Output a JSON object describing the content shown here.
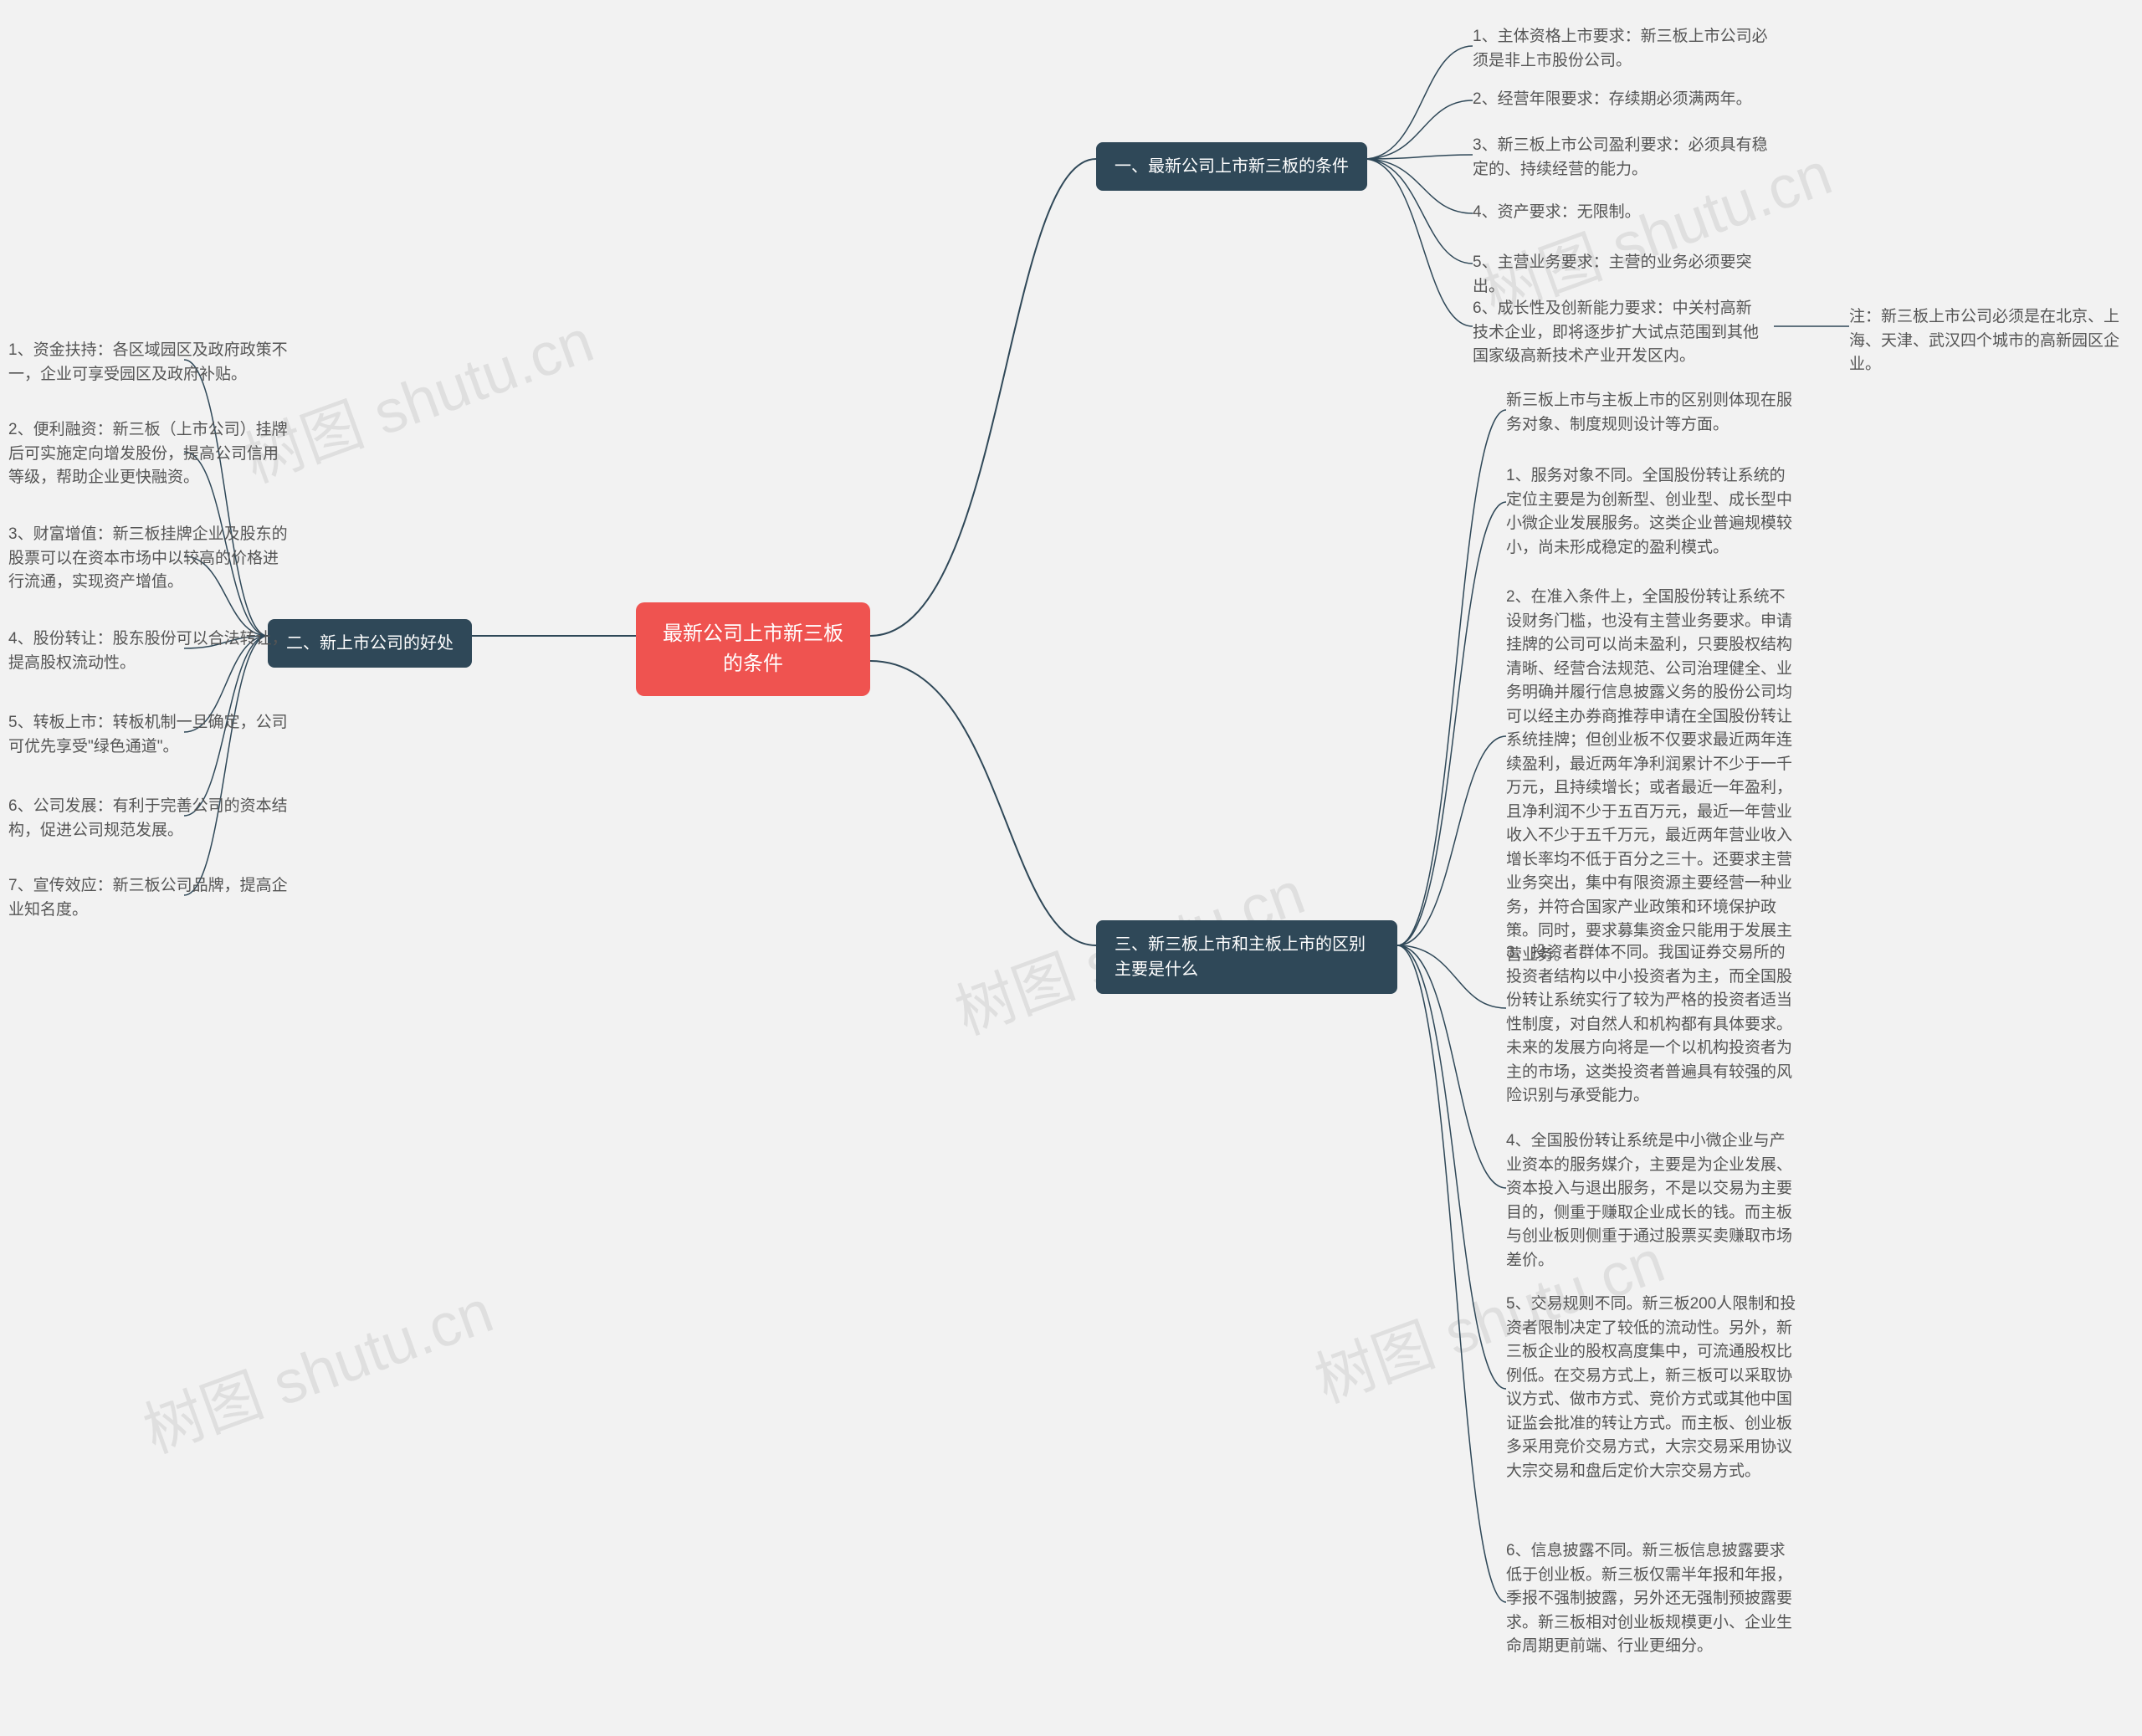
{
  "root": {
    "title": "最新公司上市新三板的条件"
  },
  "watermark": "树图 shutu.cn",
  "branch1": {
    "title": "一、最新公司上市新三板的条件",
    "items": [
      "1、主体资格上市要求：新三板上市公司必须是非上市股份公司。",
      "2、经营年限要求：存续期必须满两年。",
      "3、新三板上市公司盈利要求：必须具有稳定的、持续经营的能力。",
      "4、资产要求：无限制。",
      "5、主营业务要求：主营的业务必须要突出。",
      "6、成长性及创新能力要求：中关村高新技术企业，即将逐步扩大试点范围到其他国家级高新技术产业开发区内。"
    ],
    "note": "注：新三板上市公司必须是在北京、上海、天津、武汉四个城市的高新园区企业。"
  },
  "branch2": {
    "title": "二、新上市公司的好处",
    "items": [
      "1、资金扶持：各区域园区及政府政策不一，企业可享受园区及政府补贴。",
      "2、便利融资：新三板（上市公司）挂牌后可实施定向增发股份，提高公司信用等级，帮助企业更快融资。",
      "3、财富增值：新三板挂牌企业及股东的股票可以在资本市场中以较高的价格进行流通，实现资产增值。",
      "4、股份转让：股东股份可以合法转让，提高股权流动性。",
      "5、转板上市：转板机制一旦确定，公司可优先享受\"绿色通道\"。",
      "6、公司发展：有利于完善公司的资本结构，促进公司规范发展。",
      "7、宣传效应：新三板公司品牌，提高企业知名度。"
    ]
  },
  "branch3": {
    "title": "三、新三板上市和主板上市的区别主要是什么",
    "items": [
      "新三板上市与主板上市的区别则体现在服务对象、制度规则设计等方面。",
      "1、服务对象不同。全国股份转让系统的定位主要是为创新型、创业型、成长型中小微企业发展服务。这类企业普遍规模较小，尚未形成稳定的盈利模式。",
      "2、在准入条件上，全国股份转让系统不设财务门槛，也没有主营业务要求。申请挂牌的公司可以尚未盈利，只要股权结构清晰、经营合法规范、公司治理健全、业务明确并履行信息披露义务的股份公司均可以经主办券商推荐申请在全国股份转让系统挂牌；但创业板不仅要求最近两年连续盈利，最近两年净利润累计不少于一千万元，且持续增长；或者最近一年盈利，且净利润不少于五百万元，最近一年营业收入不少于五千万元，最近两年营业收入增长率均不低于百分之三十。还要求主营业务突出，集中有限资源主要经营一种业务，并符合国家产业政策和环境保护政策。同时，要求募集资金只能用于发展主营业务。",
      "3、投资者群体不同。我国证券交易所的投资者结构以中小投资者为主，而全国股份转让系统实行了较为严格的投资者适当性制度，对自然人和机构都有具体要求。未来的发展方向将是一个以机构投资者为主的市场，这类投资者普遍具有较强的风险识别与承受能力。",
      "4、全国股份转让系统是中小微企业与产业资本的服务媒介，主要是为企业发展、资本投入与退出服务，不是以交易为主要目的，侧重于赚取企业成长的钱。而主板与创业板则侧重于通过股票买卖赚取市场差价。",
      "5、交易规则不同。新三板200人限制和投资者限制决定了较低的流动性。另外，新三板企业的股权高度集中，可流通股权比例低。在交易方式上，新三板可以采取协议方式、做市方式、竞价方式或其他中国证监会批准的转让方式。而主板、创业板多采用竞价交易方式，大宗交易采用协议大宗交易和盘后定价大宗交易方式。",
      "6、信息披露不同。新三板信息披露要求低于创业板。新三板仅需半年报和年报，季报不强制披露，另外还无强制预披露要求。新三板相对创业板规模更小、企业生命周期更前端、行业更细分。"
    ]
  }
}
